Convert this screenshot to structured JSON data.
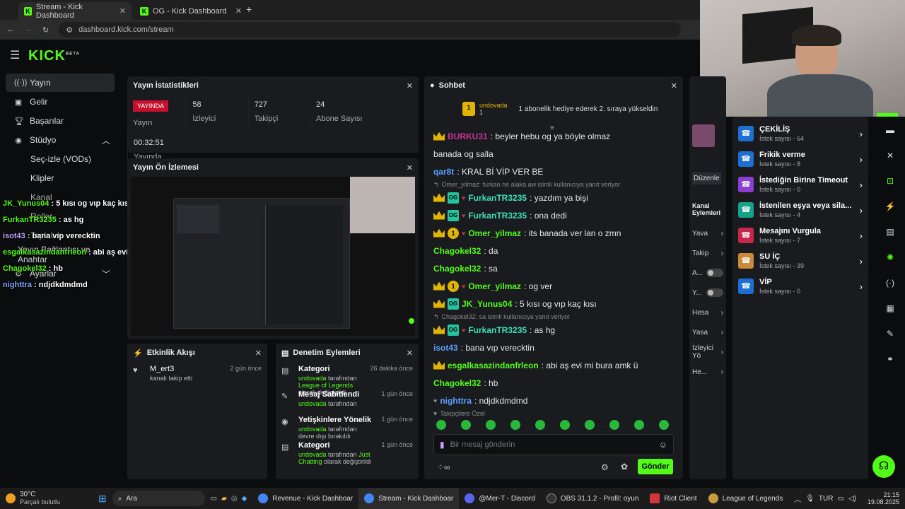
{
  "browser": {
    "tabs": [
      {
        "title": "Stream - Kick Dashboard"
      },
      {
        "title": "OG - Kick Dashboard"
      }
    ],
    "url": "dashboard.kick.com/stream"
  },
  "brand": {
    "logo": "KICK",
    "beta": "BETA",
    "accent": "#53fc18"
  },
  "sidebar": {
    "items": [
      {
        "label": "Yayın",
        "icon": "broadcast-icon"
      },
      {
        "label": "Gelir",
        "icon": "money-icon"
      },
      {
        "label": "Başarılar",
        "icon": "trophy-icon"
      },
      {
        "label": "Stüdyo",
        "icon": "studio-icon"
      },
      {
        "label": "Seç-izle (VODs)"
      },
      {
        "label": "Klipler"
      },
      {
        "label": "Kanal"
      },
      {
        "label": "Roller"
      },
      {
        "label": "Topluluk"
      },
      {
        "label": "Yayın Bağlantısı ve Anahtar"
      },
      {
        "label": "Ayarlar",
        "icon": "gear-icon"
      }
    ]
  },
  "overlay_chat": [
    {
      "user": "JK_Yunus04",
      "text": " : 5 kısı og vıp kaç kısı"
    },
    {
      "user": "FurkanTR3235",
      "text": " : as hg"
    },
    {
      "user": "isot43",
      "text": " : bana vıp verecktin"
    },
    {
      "user": "esgalkasazindanfrleon",
      "text": " : abi aş evi mi bura amk ü"
    },
    {
      "user": "Chagokel32",
      "text": " : hb"
    },
    {
      "user": "nighttra",
      "text": " : ndjdkdmdmd"
    }
  ],
  "stats": {
    "title": "Yayın İstatistikleri",
    "live": "YAYINDA",
    "live_label": "Yayın",
    "viewers": "58",
    "viewers_label": "İzleyici",
    "followers": "727",
    "followers_label": "Takipçi",
    "subs": "24",
    "subs_label": "Abone Sayısı",
    "uptime": "00:32:51",
    "uptime_label": "Yayında Olduğu Süre"
  },
  "preview": {
    "title": "Yayın Ön İzlemesi"
  },
  "activity": {
    "title": "Etkinlik Akışı",
    "items": [
      {
        "user": "M_ert3",
        "desc": "kanalı takip etti",
        "time": "2 gün önce"
      }
    ]
  },
  "moderation": {
    "title": "Denetim Eylemleri",
    "items": [
      {
        "title": "Kategori",
        "pre": "undovada",
        "mid": " tarafından ",
        "hl": "League of Legends",
        "post": " olarak değiştirildi",
        "time": "26 dakika önce",
        "icon": "category-icon"
      },
      {
        "title": "Mesaj Sabitlendi",
        "pre": "undovada",
        "mid": " tarafından",
        "hl": "",
        "post": "",
        "time": "1 gün önce",
        "icon": "pin-icon"
      },
      {
        "title": "Yetişkinlere Yönelik",
        "pre": "undovada",
        "mid": " tarafından devre dışı bırakıldı",
        "hl": "",
        "post": "",
        "time": "1 gün önce",
        "icon": "eye-icon"
      },
      {
        "title": "Kategori",
        "pre": "undovada",
        "mid": " tarafından ",
        "hl": "Just Chatting",
        "post": " olarak değiştirildi",
        "time": "1 gün önce",
        "icon": "category-icon"
      }
    ]
  },
  "chat": {
    "title": "Sohbet",
    "gifter": "undovada",
    "gifter_count": "1",
    "gift_msg": "1 abonelik hediye ederek 2. sıraya yükseldin",
    "messages": [
      {
        "user": "BURKU31",
        "text": ": beyler hebu og ya böyle olmaz",
        "cls": "n-mag",
        "cont": "banada og salla"
      },
      {
        "user": "qar8t",
        "text": ": KRAL Bİ VİP VER BE",
        "cls": "n-blue"
      },
      {
        "reply": "Omer_yilmaz: furkan ne alaka aw isimli kullanıcıya yanıt veriyor"
      },
      {
        "user": "FurkanTR3235",
        "text": ": yazdım ya bişi",
        "cls": "n-teal"
      },
      {
        "user": "FurkanTR3235",
        "text": ": ona dedi",
        "cls": "n-teal"
      },
      {
        "user": "Omer_yilmaz",
        "text": ": its banada ver lan o zmn",
        "cls": "n-green"
      },
      {
        "user": "Chagokel32",
        "text": ": da",
        "cls": "n-green"
      },
      {
        "user": "Chagokel32",
        "text": ": sa",
        "cls": "n-green"
      },
      {
        "user": "Omer_yilmaz",
        "text": ": og ver",
        "cls": "n-green"
      },
      {
        "user": "JK_Yunus04",
        "text": ": 5 kısı og vıp kaç kısı",
        "cls": "n-green"
      },
      {
        "reply": "Chagokel32: sa isimli kullanıcıya yanıt veriyor"
      },
      {
        "user": "FurkanTR3235",
        "text": ": as hg",
        "cls": "n-teal"
      },
      {
        "user": "isot43",
        "text": ": bana vıp verecktin",
        "cls": "n-blue"
      },
      {
        "user": "esgalkasazindanfrleon",
        "text": ": abi aş evi mi bura amk ü",
        "cls": "n-green"
      },
      {
        "user": "Chagokel32",
        "text": ": hb",
        "cls": "n-green"
      },
      {
        "user": "nighttra",
        "text": ": ndjdkdmdmd",
        "cls": "n-blue"
      }
    ],
    "followers_only": "Takipçilere Özel",
    "placeholder": "Bir mesaj gönderin",
    "send": "Gönder"
  },
  "rewards": {
    "items": [
      {
        "title": "ÇEKİLİŞ",
        "sub": "İstek sayısı - 64",
        "color": "#1d6fd1"
      },
      {
        "title": "Frikik verme",
        "sub": "İstek sayısı - 8",
        "color": "#1d6fd1"
      },
      {
        "title": "İstediğin Birine Timeout",
        "sub": "İstek sayısı - 0",
        "color": "#8b3fd1"
      },
      {
        "title": "İstenilen eşya veya sila...",
        "sub": "İstek sayısı - 4",
        "color": "#12a38a"
      },
      {
        "title": "Mesajını Vurgula",
        "sub": "İstek sayısı - 7",
        "color": "#c8264a"
      },
      {
        "title": "SU İÇ",
        "sub": "İstek sayısı - 39",
        "color": "#c98a3a"
      },
      {
        "title": "VİP",
        "sub": "İstek sayısı - 0",
        "color": "#1d6fd1"
      }
    ]
  },
  "channel_actions": {
    "edit": "Düzenle",
    "title": "Kanal Eylemleri",
    "items": [
      "Yava",
      "Takip",
      "A...",
      "Y...",
      "Hesa",
      "Yasa",
      "İzleyici Yö",
      "He..."
    ]
  },
  "taskbar": {
    "weather": "30°C",
    "weather_desc": "Parçalı bulutlu",
    "search": "Ara",
    "apps": [
      "Revenue - Kick Dashboar",
      "Stream - Kick Dashboar",
      "@Mer-T - Discord",
      "OBS 31.1.2 - Profil: oyun",
      "Riot Client",
      "League of Legends"
    ],
    "lang": "TUR",
    "time": "21:15",
    "date": "19.08.2025"
  }
}
